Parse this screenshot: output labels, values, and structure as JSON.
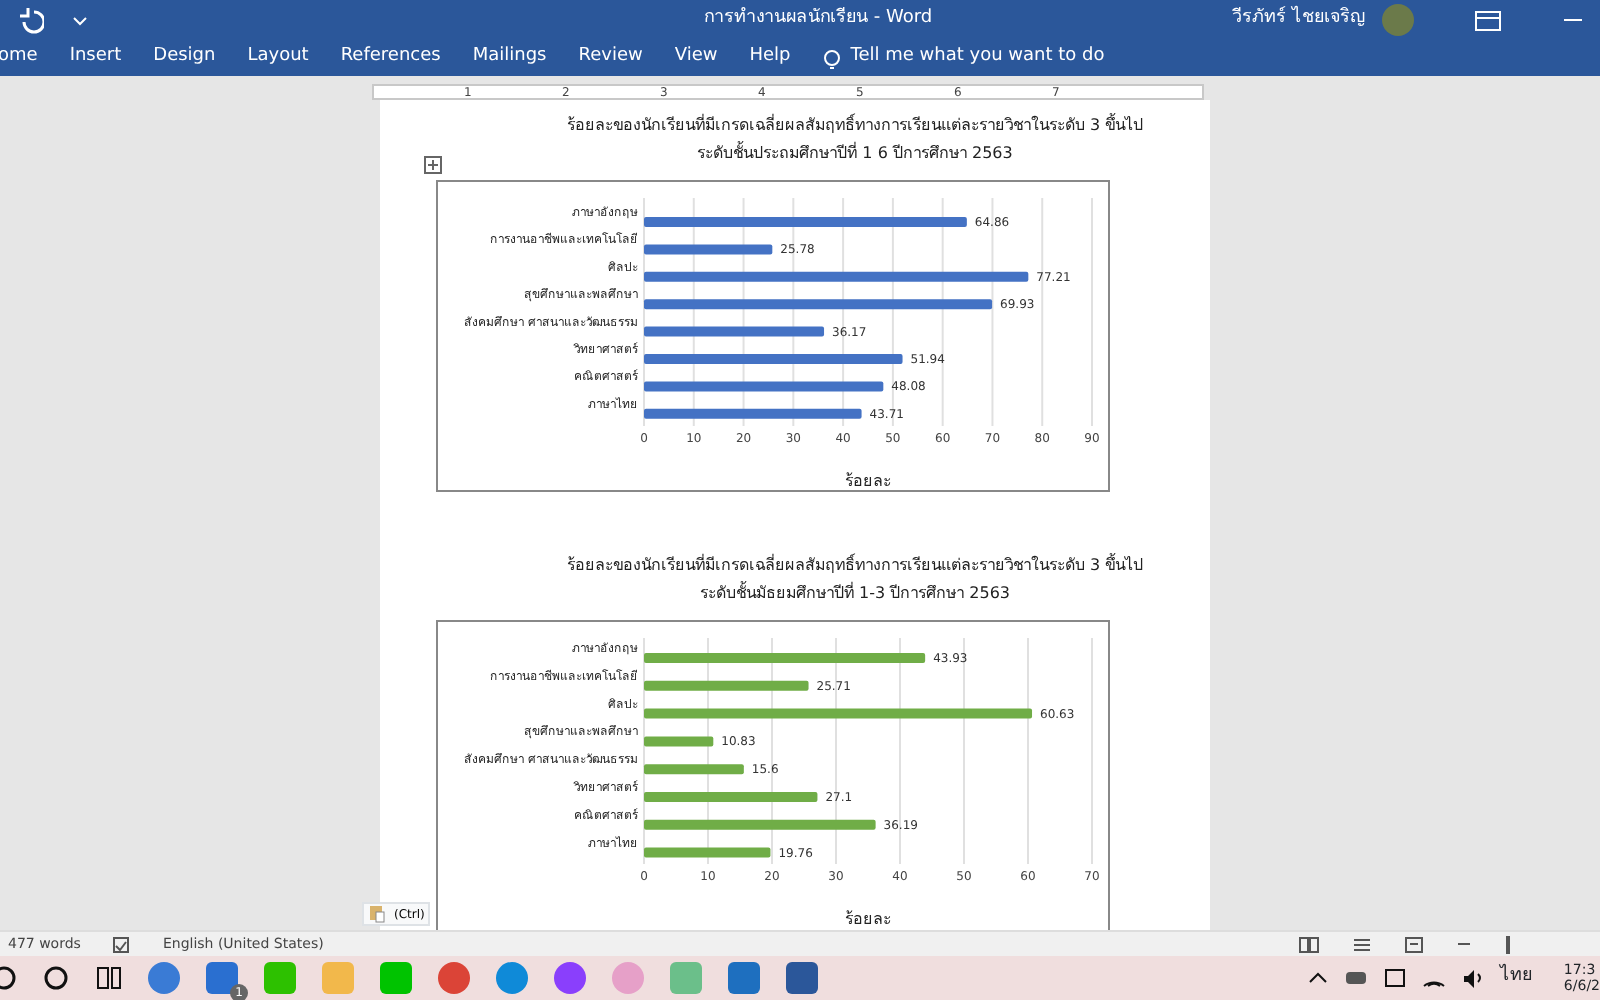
{
  "window": {
    "title": "การทำงานผลนักเรียน  -  Word",
    "user": "วีรภัทร์ ไชยเจริญ"
  },
  "ribbon_tabs": [
    "ome",
    "Insert",
    "Design",
    "Layout",
    "References",
    "Mailings",
    "Review",
    "View",
    "Help"
  ],
  "tell_me": {
    "placeholder": "Tell me what you want to do"
  },
  "ruler": [
    "1",
    "2",
    "3",
    "4",
    "5",
    "6",
    "7"
  ],
  "charts": [
    {
      "heading": [
        "ร้อยละของนักเรียนที่มีเกรดเฉลี่ยผลสัมฤทธิ์ทางการเรียนแต่ละรายวิชาในระดับ 3 ขึ้นไป",
        "ระดับชั้นประถมศึกษาปีที่ 1  6 ปีการศึกษา  2563"
      ],
      "chart_data": {
        "type": "bar",
        "orientation": "horizontal",
        "xlabel": "ร้อยละ",
        "categories": [
          "ภาษาอังกฤษ",
          "การงานอาชีพและเทคโนโลยี",
          "ศิลปะ",
          "สุขศึกษาและพลศึกษา",
          "สังคมศึกษา ศาสนาและวัฒนธรรม",
          "วิทยาศาสตร์",
          "คณิตศาสตร์",
          "ภาษาไทย"
        ],
        "series": [
          {
            "color": "#4472c4",
            "values": [
              64.86,
              25.78,
              77.21,
              69.93,
              36.17,
              51.94,
              48.08,
              43.71
            ]
          }
        ],
        "value_labels": [
          "64.86",
          "25.78",
          "77.21",
          "69.93",
          "36.17",
          "51.94",
          "48.08",
          "43.71"
        ],
        "grid": true,
        "xlim": [
          0,
          90
        ],
        "xticks": [
          0,
          10,
          20,
          30,
          40,
          50,
          60,
          70,
          80,
          90
        ]
      }
    },
    {
      "heading": [
        "ร้อยละของนักเรียนที่มีเกรดเฉลี่ยผลสัมฤทธิ์ทางการเรียนแต่ละรายวิชาในระดับ 3 ขึ้นไป",
        "ระดับชั้นมัธยมศึกษาปีที่ 1-3 ปีการศึกษา  2563"
      ],
      "chart_data": {
        "type": "bar",
        "orientation": "horizontal",
        "xlabel": "ร้อยละ",
        "categories": [
          "ภาษาอังกฤษ",
          "การงานอาชีพและเทคโนโลยี",
          "ศิลปะ",
          "สุขศึกษาและพลศึกษา",
          "สังคมศึกษา ศาสนาและวัฒนธรรม",
          "วิทยาศาสตร์",
          "คณิตศาสตร์",
          "ภาษาไทย"
        ],
        "series": [
          {
            "color": "#70ad47",
            "values": [
              43.93,
              25.71,
              60.63,
              10.83,
              15.6,
              27.1,
              36.19,
              19.76
            ]
          }
        ],
        "value_labels": [
          "43.93",
          "25.71",
          "60.63",
          "10.83",
          "15.6",
          "27.1",
          "36.19",
          "19.76"
        ],
        "grid": true,
        "xlim": [
          0,
          70
        ],
        "xticks": [
          0,
          10,
          20,
          30,
          40,
          50,
          60,
          70
        ]
      }
    }
  ],
  "paste_options": "(Ctrl)",
  "status_bar": {
    "words": "477 words",
    "language": "English (United States)"
  },
  "taskbar": {
    "mail_badge": "1",
    "time": "17:3",
    "date": "6/6/2",
    "lang": "ไทย"
  }
}
